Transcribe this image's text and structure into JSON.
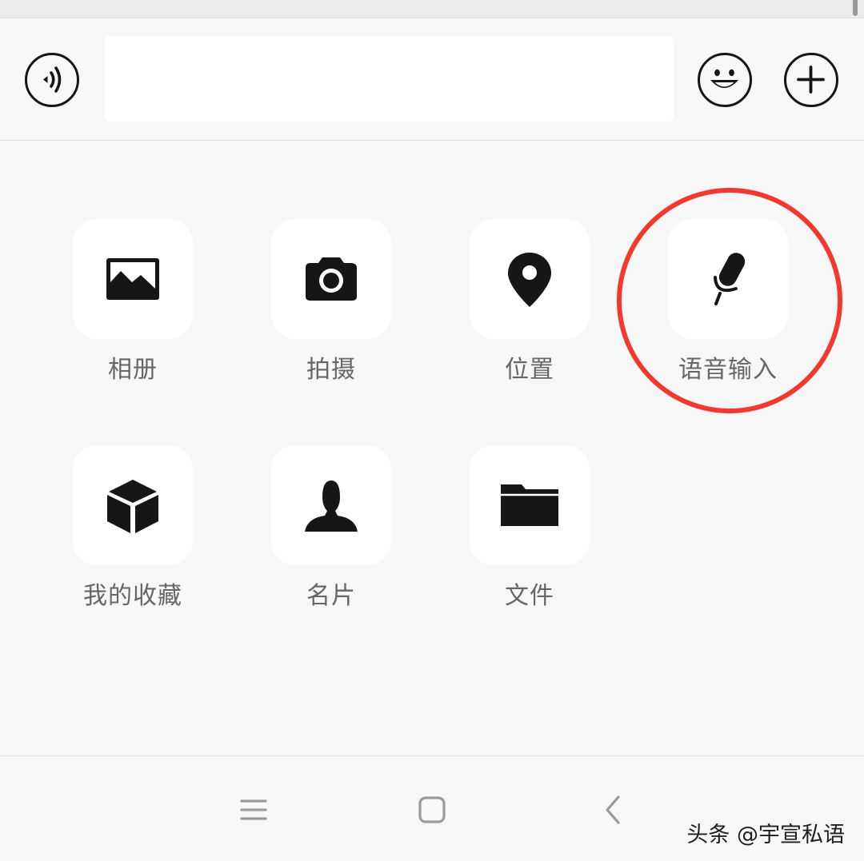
{
  "input_bar": {
    "voice_button_icon": "voice-wave-icon",
    "message_input_value": "",
    "emoji_button_icon": "smiley-face-icon",
    "more_button_icon": "plus-icon"
  },
  "panel": {
    "items": [
      {
        "label": "相册",
        "icon": "photo-album-icon"
      },
      {
        "label": "拍摄",
        "icon": "camera-icon"
      },
      {
        "label": "位置",
        "icon": "location-pin-icon"
      },
      {
        "label": "语音输入",
        "icon": "microphone-icon"
      },
      {
        "label": "我的收藏",
        "icon": "cube-favorites-icon"
      },
      {
        "label": "名片",
        "icon": "contact-card-person-icon"
      },
      {
        "label": "文件",
        "icon": "folder-icon"
      }
    ],
    "highlighted_item": "语音输入",
    "highlight_color": "#f2392f"
  },
  "nav_bar": {
    "menu_icon": "menu-lines-icon",
    "home_icon": "square-home-icon",
    "back_icon": "chevron-left-icon"
  },
  "watermark": "头条 @宇宣私语",
  "colors": {
    "background": "#f7f7f7",
    "card": "#ffffff",
    "icon": "#161616",
    "label": "#666666"
  }
}
